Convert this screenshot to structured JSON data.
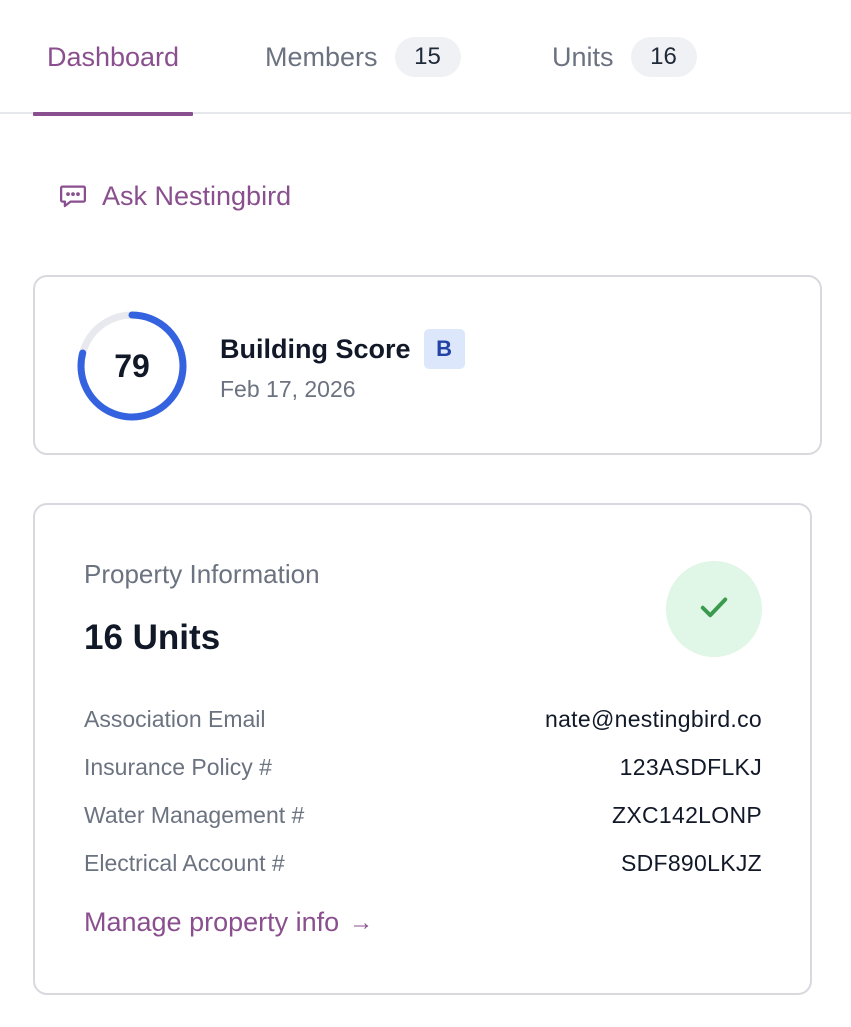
{
  "tabs": {
    "dashboard": {
      "label": "Dashboard"
    },
    "members": {
      "label": "Members",
      "count": "15"
    },
    "units": {
      "label": "Units",
      "count": "16"
    }
  },
  "ask": {
    "label": "Ask Nestingbird",
    "icon": "chat-bubble-icon"
  },
  "score_card": {
    "score": "79",
    "score_fraction": 0.79,
    "title": "Building Score",
    "grade": "B",
    "date": "Feb 17, 2026"
  },
  "property": {
    "label": "Property Information",
    "units": "16 Units",
    "status_icon": "check-icon",
    "rows": [
      {
        "key": "Association Email",
        "value": "nate@nestingbird.co"
      },
      {
        "key": "Insurance Policy #",
        "value": "123ASDFLKJ"
      },
      {
        "key": "Water Management #",
        "value": "ZXC142LONP"
      },
      {
        "key": "Electrical Account #",
        "value": "SDF890LKJZ"
      }
    ],
    "manage_label": "Manage property info",
    "manage_arrow": "→"
  },
  "colors": {
    "accent": "#8a4f8e",
    "gauge": "#3563e0",
    "gauge_track": "#e8e9ee",
    "success": "#3a9a4d",
    "success_bg": "#e0f6e6",
    "grade_bg": "#dce7fb",
    "grade_text": "#2443a6"
  }
}
